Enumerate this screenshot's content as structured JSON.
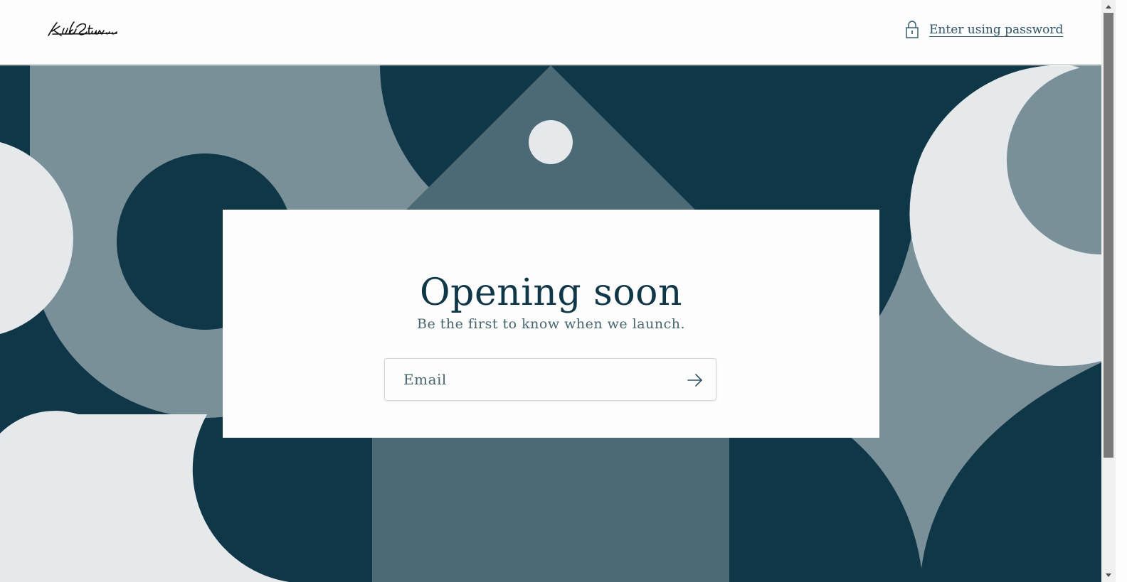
{
  "header": {
    "logo_text": "KidStance",
    "password_link": "Enter using password",
    "password_icon": "lock-icon"
  },
  "main": {
    "title": "Opening soon",
    "subtitle": "Be the first to know when we launch.",
    "email_label": "Email",
    "submit_icon": "arrow-right-icon"
  },
  "colors": {
    "navy": "#0f3747",
    "slate": "#4b6a76",
    "gray_blue": "#7a9099",
    "light": "#e5e9eb",
    "white": "#fdfdfd"
  }
}
